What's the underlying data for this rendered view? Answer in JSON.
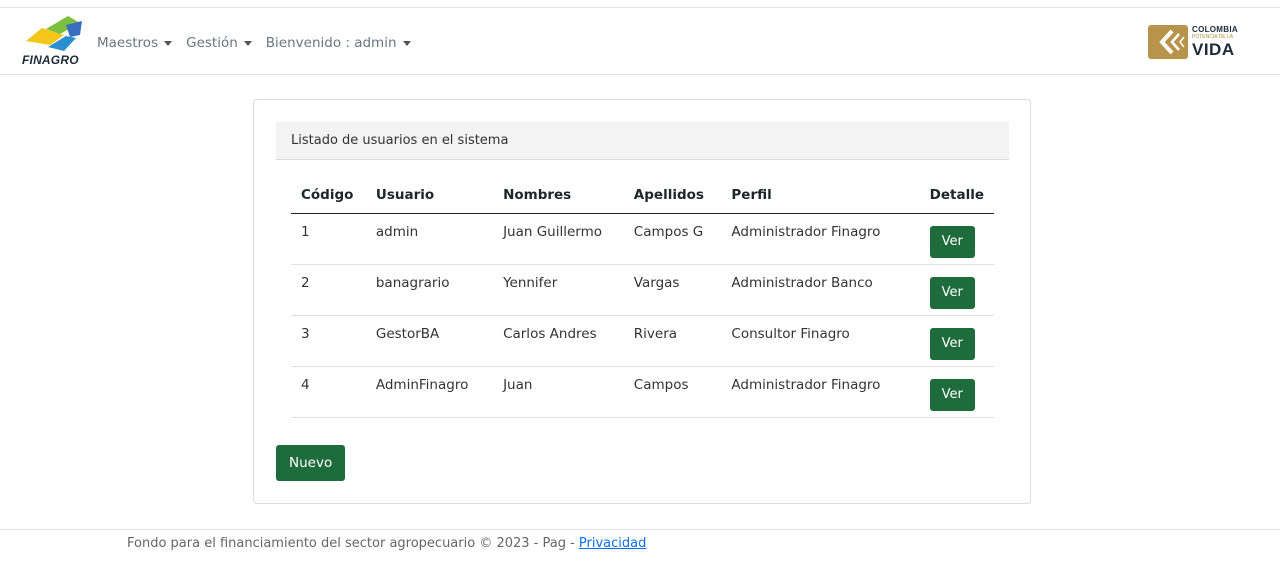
{
  "brand": {
    "name": "FINAGRO"
  },
  "nav": [
    {
      "label": "Maestros"
    },
    {
      "label": "Gestión"
    },
    {
      "label": "Bienvenido : admin"
    }
  ],
  "gov_logo": {
    "line1": "COLOMBIA",
    "line2": "POTENCIA DE LA",
    "line3": "VIDA"
  },
  "card": {
    "header": "Listado de usuarios en el sistema",
    "columns": [
      "Código",
      "Usuario",
      "Nombres",
      "Apellidos",
      "Perfil",
      "Detalle"
    ],
    "rows": [
      {
        "codigo": "1",
        "usuario": "admin",
        "nombres": "Juan Guillermo",
        "apellidos": "Campos G",
        "perfil": "Administrador Finagro",
        "action": "Ver"
      },
      {
        "codigo": "2",
        "usuario": "banagrario",
        "nombres": "Yennifer",
        "apellidos": "Vargas",
        "perfil": "Administrador Banco",
        "action": "Ver"
      },
      {
        "codigo": "3",
        "usuario": "GestorBA",
        "nombres": "Carlos Andres",
        "apellidos": "Rivera",
        "perfil": "Consultor Finagro",
        "action": "Ver"
      },
      {
        "codigo": "4",
        "usuario": "AdminFinagro",
        "nombres": "Juan",
        "apellidos": "Campos",
        "perfil": "Administrador Finagro",
        "action": "Ver"
      }
    ],
    "new_button": "Nuevo"
  },
  "footer": {
    "text": "Fondo para el financiamiento del sector agropecuario © 2023 - Pag - ",
    "link": "Privacidad"
  },
  "colors": {
    "primary_button": "#1e6b3c",
    "link": "#0d6efd",
    "muted_text": "#6c757d"
  }
}
